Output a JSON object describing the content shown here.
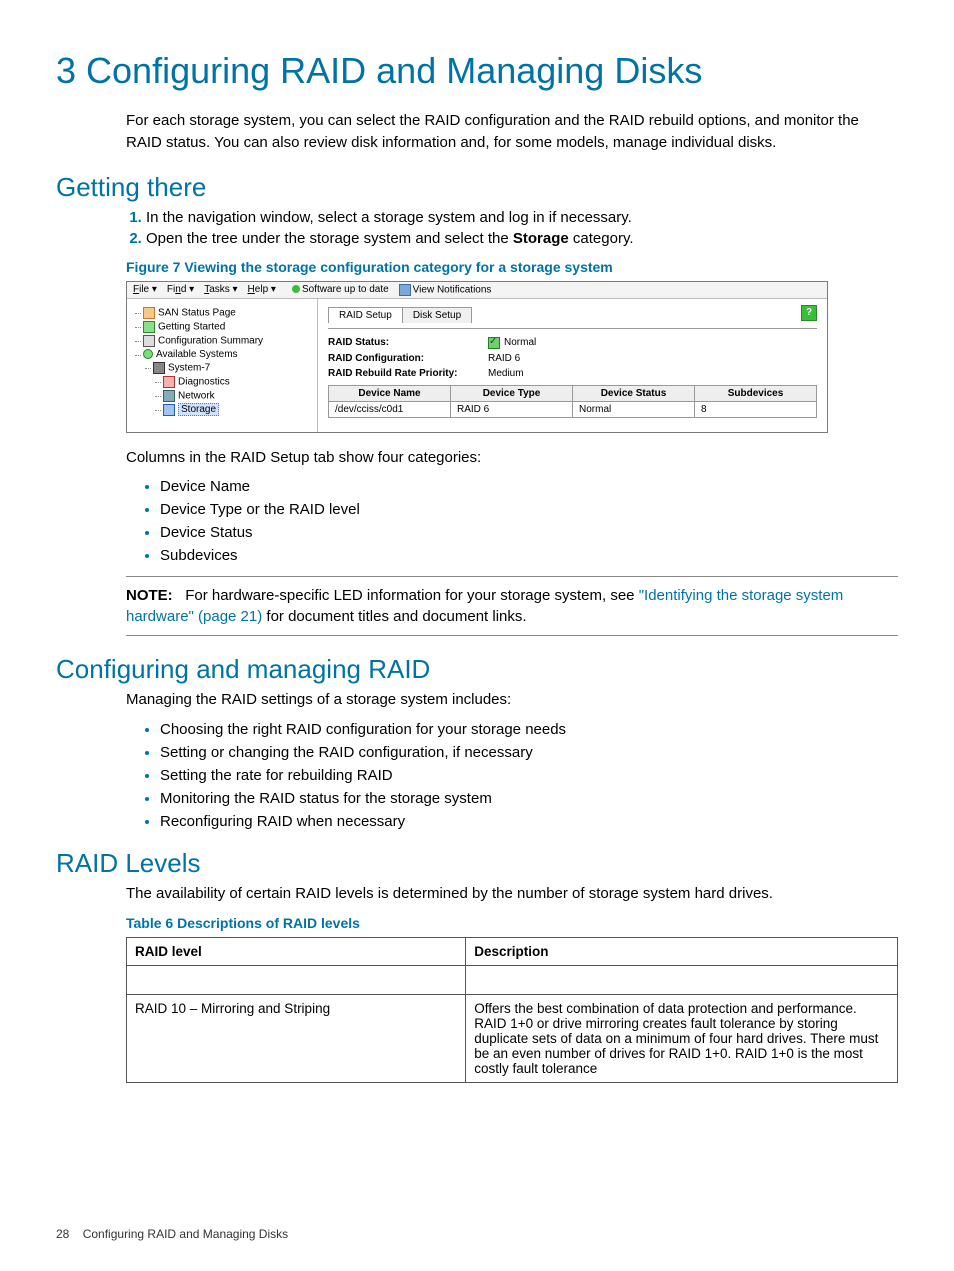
{
  "h1": "3 Configuring RAID and Managing Disks",
  "intro": "For each storage system, you can select the RAID configuration and the RAID rebuild options, and monitor the RAID status. You can also review disk information and, for some models, manage individual disks.",
  "getting_there": {
    "heading": "Getting there",
    "steps": [
      "In the navigation window, select a storage system and log in if necessary.",
      "Open the tree under the storage system and select the Storage category."
    ],
    "step2_bold": "Storage",
    "figure_caption": "Figure 7 Viewing the storage configuration category for a storage system"
  },
  "screenshot": {
    "menus": {
      "file": "File",
      "find": "Find",
      "tasks": "Tasks",
      "help": "Help"
    },
    "status_text": "Software up to date",
    "view_notifications": "View Notifications",
    "tree": {
      "san_status": "SAN Status Page",
      "getting_started": "Getting Started",
      "config_summary": "Configuration Summary",
      "available": "Available Systems",
      "system": "System-7",
      "diagnostics": "Diagnostics",
      "network": "Network",
      "storage": "Storage"
    },
    "tabs": {
      "raid_setup": "RAID Setup",
      "disk_setup": "Disk Setup"
    },
    "help_icon": "?",
    "kv": {
      "raid_status_label": "RAID Status:",
      "raid_status_value": "Normal",
      "raid_config_label": "RAID Configuration:",
      "raid_config_value": "RAID 6",
      "raid_priority_label": "RAID Rebuild Rate Priority:",
      "raid_priority_value": "Medium"
    },
    "table_headers": [
      "Device Name",
      "Device Type",
      "Device Status",
      "Subdevices"
    ],
    "table_row": [
      "/dev/cciss/c0d1",
      "RAID 6",
      "Normal",
      "8"
    ]
  },
  "columns_intro": "Columns in the RAID Setup tab show four categories:",
  "columns": [
    "Device Name",
    "Device Type or the RAID level",
    "Device Status",
    "Subdevices"
  ],
  "note": {
    "label": "NOTE:",
    "text_before_link": "For hardware-specific LED information for your storage system, see ",
    "link": "\"Identifying the storage system hardware\" (page 21)",
    "text_after_link": " for document titles and document links."
  },
  "configuring": {
    "heading": "Configuring and managing RAID",
    "intro": "Managing the RAID settings of a storage system includes:",
    "items": [
      "Choosing the right RAID configuration for your storage needs",
      "Setting or changing the RAID configuration, if necessary",
      "Setting the rate for rebuilding RAID",
      "Monitoring the RAID status for the storage system",
      "Reconfiguring RAID when necessary"
    ]
  },
  "raid_levels": {
    "heading": "RAID Levels",
    "intro": "The availability of certain RAID levels is determined by the number of storage system hard drives.",
    "table_caption": "Table 6 Descriptions of RAID levels",
    "headers": [
      "RAID level",
      "Description"
    ],
    "row": {
      "level": "RAID 10 – Mirroring and Striping",
      "desc": "Offers the best combination of data protection and performance. RAID 1+0 or drive mirroring creates fault tolerance by storing duplicate sets of data on a minimum of four hard drives. There must be an even number of drives for RAID 1+0. RAID 1+0 is the most costly fault tolerance"
    }
  },
  "footer": {
    "page": "28",
    "title": "Configuring RAID and Managing Disks"
  }
}
